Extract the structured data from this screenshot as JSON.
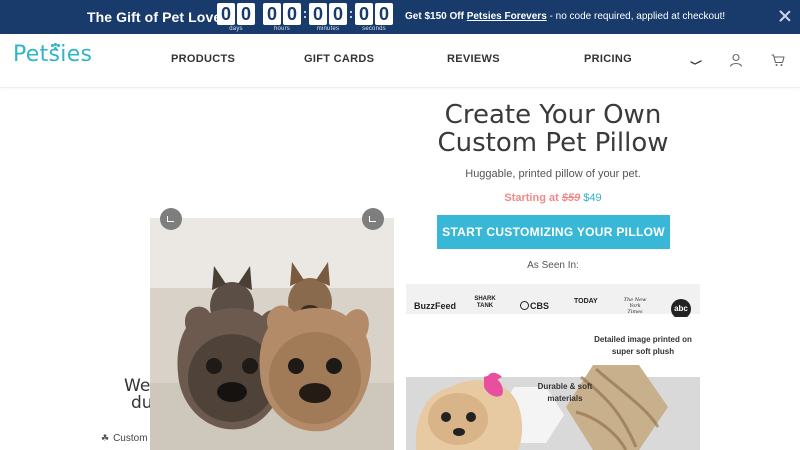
{
  "promo": {
    "title": "The Gift of Pet Love!",
    "countdown": [
      {
        "digits": [
          "0",
          "0"
        ],
        "label": "days"
      },
      {
        "digits": [
          "0",
          "0"
        ],
        "label": "hours"
      },
      {
        "digits": [
          "0",
          "0"
        ],
        "label": "minutes"
      },
      {
        "digits": [
          "0",
          "0"
        ],
        "label": "seconds"
      }
    ],
    "offer_prefix": "Get $150 Off ",
    "offer_link": "Petsies Forevers",
    "offer_suffix": " - no code required, applied at checkout!",
    "bg_color": "#183b6b"
  },
  "nav": {
    "logo": "Petsies",
    "items": [
      "PRODUCTS",
      "GIFT CARDS",
      "REVIEWS",
      "PRICING"
    ],
    "icons": [
      "search-icon",
      "user-icon",
      "cart-icon"
    ],
    "brand_color": "#2fb5c6"
  },
  "hero": {
    "title_line1": "Create Your Own",
    "title_line2": "Custom Pet Pillow",
    "subtitle": "Huggable, printed pillow of your pet.",
    "price_label": "Starting at ",
    "price_old": "$59",
    "price_new": " $49",
    "cta": "START CUSTOMIZING YOUR PILLOW",
    "cta_color": "#38b8d6",
    "seen_in": "As Seen In:",
    "press": [
      "BuzzFeed",
      "SHARK TANK",
      "CBS",
      "TODAY",
      "The New York Times",
      "abc"
    ]
  },
  "promo_image": {
    "caption_a": "Detailed image printed on super soft plush",
    "caption_b": "Durable & soft materials"
  },
  "left": {
    "welcome_line1": "We",
    "welcome_line2": "du",
    "custom_text": "Custom"
  },
  "photo": {
    "alt": "Two French bulldog pillows with two French bulldogs"
  }
}
